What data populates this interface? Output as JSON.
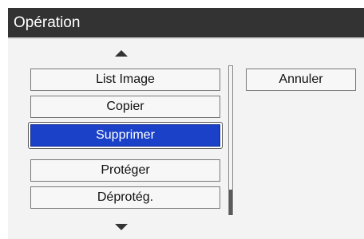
{
  "dialog": {
    "title": "Opération"
  },
  "menu": {
    "items": [
      {
        "label": "List Image",
        "selected": false
      },
      {
        "label": "Copier",
        "selected": false
      },
      {
        "label": "Supprimer",
        "selected": true
      },
      {
        "label": "Protéger",
        "selected": false
      },
      {
        "label": "Déprotég.",
        "selected": false
      }
    ],
    "scroll_up_icon": "triangle-up",
    "scroll_down_icon": "triangle-down"
  },
  "actions": {
    "cancel_label": "Annuler"
  },
  "colors": {
    "titlebar": "#333333",
    "selected_fill": "#1a41c7",
    "panel": "#f3f3f3"
  }
}
